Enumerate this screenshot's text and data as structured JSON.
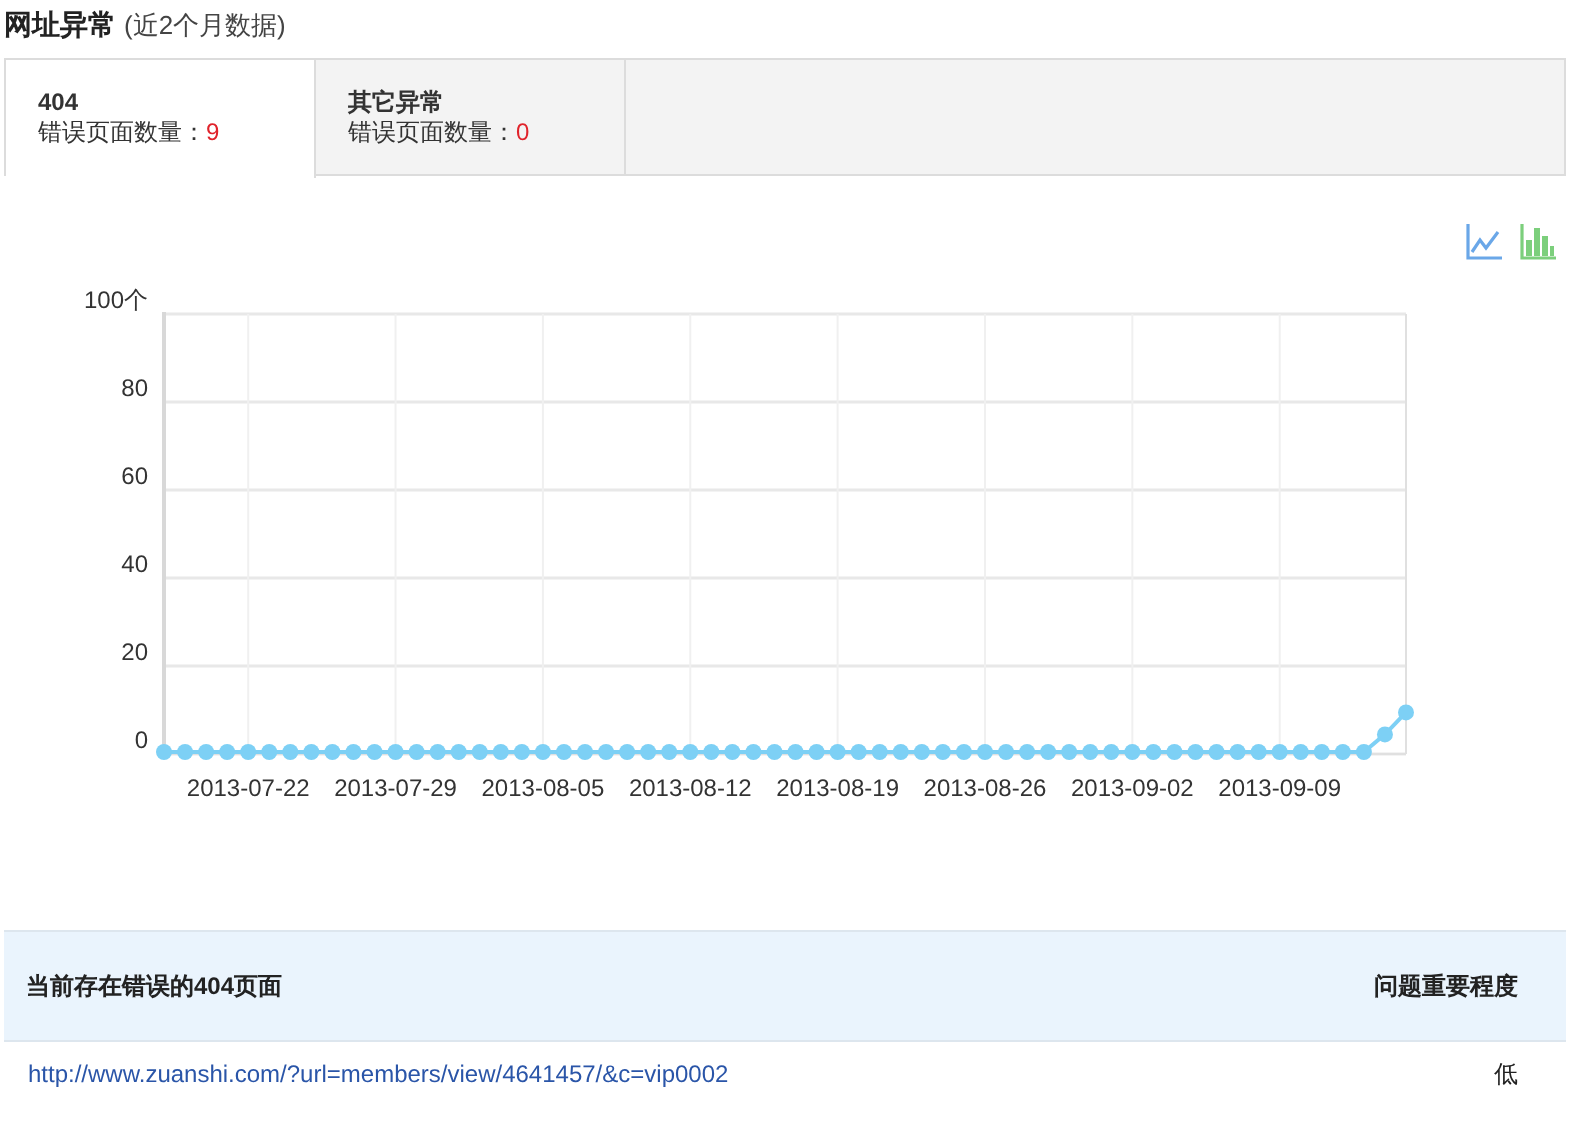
{
  "header": {
    "title": "网址异常",
    "subtitle": "(近2个月数据)"
  },
  "tabs": [
    {
      "title": "404",
      "label": "错误页面数量：",
      "count": "9",
      "selected": true
    },
    {
      "title": "其它异常",
      "label": "错误页面数量：",
      "count": "0",
      "selected": false
    }
  ],
  "chart_toggle": [
    {
      "kind": "line",
      "selected": true
    },
    {
      "kind": "bar",
      "selected": false
    }
  ],
  "chart_data": {
    "type": "line",
    "grid": true,
    "categories": [
      null,
      null,
      null,
      null,
      "2013-07-22",
      null,
      null,
      null,
      null,
      null,
      null,
      "2013-07-29",
      null,
      null,
      null,
      null,
      null,
      null,
      "2013-08-05",
      null,
      null,
      null,
      null,
      null,
      null,
      "2013-08-12",
      null,
      null,
      null,
      null,
      null,
      null,
      "2013-08-19",
      null,
      null,
      null,
      null,
      null,
      null,
      "2013-08-26",
      null,
      null,
      null,
      null,
      null,
      null,
      "2013-09-02",
      null,
      null,
      null,
      null,
      null,
      null,
      "2013-09-09",
      null,
      null,
      null,
      null,
      null,
      null
    ],
    "series": [
      {
        "color": "#7dd0f5",
        "marker": "circle",
        "values": [
          0,
          0,
          0,
          0,
          0,
          0,
          0,
          0,
          0,
          0,
          0,
          0,
          0,
          0,
          0,
          0,
          0,
          0,
          0,
          0,
          0,
          0,
          0,
          0,
          0,
          0,
          0,
          0,
          0,
          0,
          0,
          0,
          0,
          0,
          0,
          0,
          0,
          0,
          0,
          0,
          0,
          0,
          0,
          0,
          0,
          0,
          0,
          0,
          0,
          0,
          0,
          0,
          0,
          0,
          0,
          0,
          0,
          0,
          4,
          9
        ]
      }
    ],
    "ylim": [
      0,
      100
    ],
    "yticks": [
      0,
      20,
      40,
      60,
      80,
      {
        "value": 100,
        "label": "100个"
      }
    ]
  },
  "table": {
    "columns": [
      "当前存在错误的404页面",
      "问题重要程度"
    ],
    "rows": [
      {
        "url": "http://www.zuanshi.com/?url=members/view/4641457/&c=vip0002",
        "importance": "低"
      }
    ]
  }
}
